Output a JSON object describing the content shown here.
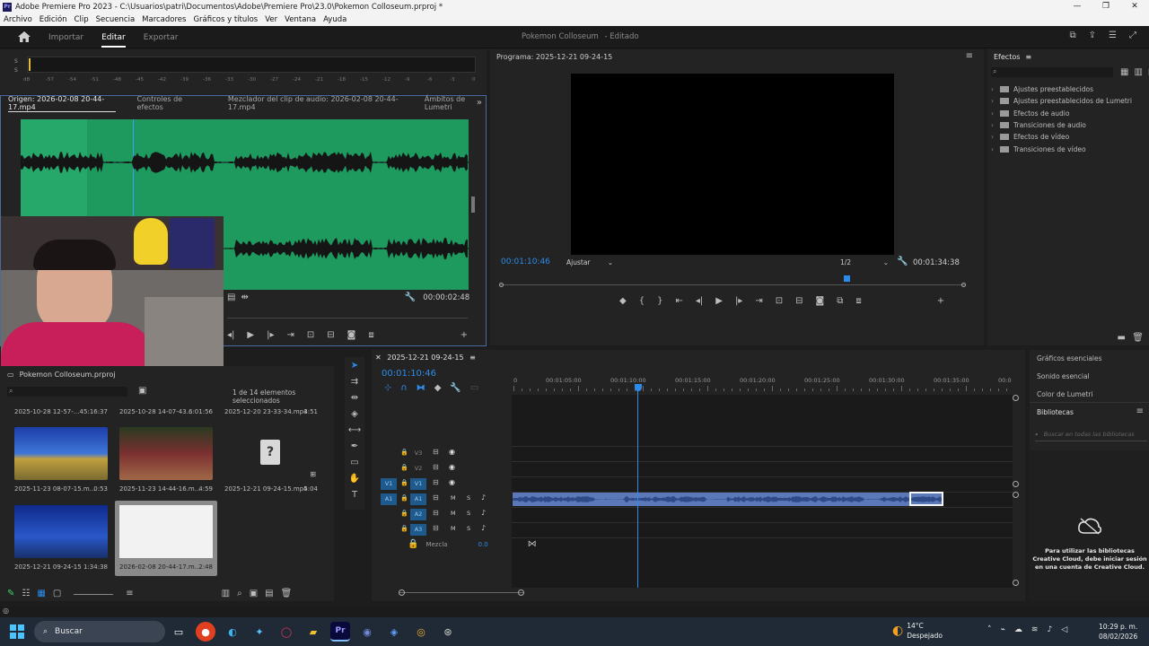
{
  "window": {
    "title": "Adobe Premiere Pro 2023 - C:\\Usuarios\\patri\\Documentos\\Adobe\\Premiere Pro\\23.0\\Pokemon Colloseum.prproj *",
    "icon_text": "Pr",
    "minimize": "—",
    "maximize": "❐",
    "close": "✕"
  },
  "menu": [
    "Archivo",
    "Edición",
    "Clip",
    "Secuencia",
    "Marcadores",
    "Gráficos y títulos",
    "Ver",
    "Ventana",
    "Ayuda"
  ],
  "header": {
    "tabs": [
      "Importar",
      "Editar",
      "Exportar"
    ],
    "active_tab": "Editar",
    "project_title": "Pokemon Colloseum",
    "project_status": "- Editado"
  },
  "audio_meter": {
    "scale": [
      "dB",
      "-57",
      "-54",
      "-51",
      "-48",
      "-45",
      "-42",
      "-39",
      "-36",
      "-33",
      "-30",
      "-27",
      "-24",
      "-21",
      "-18",
      "-15",
      "-12",
      "-9",
      "-6",
      "-3",
      "0"
    ],
    "channel_labels": [
      "S",
      "S"
    ]
  },
  "source_panel": {
    "tabs": [
      "Origen: 2026-02-08 20-44-17.mp4",
      "Controles de efectos",
      "Mezclador del clip de audio: 2026-02-08 20-44-17.mp4",
      "Ámbitos de Lumetri"
    ],
    "active_tab": "Origen: 2026-02-08 20-44-17.mp4",
    "channel_labels": [
      "L",
      "R"
    ],
    "timecode": "00:00:02:48"
  },
  "program_panel": {
    "title": "Programa: 2025-12-21 09-24-15",
    "timecode": "00:01:10:46",
    "fit": "Ajustar",
    "resolution": "1/2",
    "duration": "00:01:34:38"
  },
  "effects_panel": {
    "title": "Efectos",
    "items": [
      "Ajustes preestablecidos",
      "Ajustes preestablecidos de Lumetri",
      "Efectos de audio",
      "Transiciones de audio",
      "Efectos de vídeo",
      "Transiciones de vídeo"
    ]
  },
  "project_panel": {
    "title": "Pokemon Colloseum.prproj",
    "selection_status": "1 de 14 elementos seleccionados",
    "top_row": [
      {
        "name": "2025-10-28 12-57-...",
        "duration": "45:16:37"
      },
      {
        "name": "2025-10-28 14-07-43...",
        "duration": "6:01:56"
      },
      {
        "name": "2025-12-20 23-33-34.mp4",
        "duration": "3:51"
      }
    ],
    "items": [
      {
        "name": "2025-11-23 08-07-15.m...",
        "duration": "0:53"
      },
      {
        "name": "2025-11-23 14-44-16.m...",
        "duration": "4:59"
      },
      {
        "name": "2025-12-21 09-24-15.mp4",
        "duration": "5:04"
      },
      {
        "name": "2025-12-21 09-24-15",
        "duration": "1:34:38"
      },
      {
        "name": "2026-02-08 20-44-17.m...",
        "duration": "2:48"
      }
    ]
  },
  "timeline": {
    "sequence_name": "2025-12-21 09-24-15",
    "timecode": "00:01:10:46",
    "ruler": [
      "0",
      "00:01:05:00",
      "00:01:10:00",
      "00:01:15:00",
      "00:01:20:00",
      "00:01:25:00",
      "00:01:30:00",
      "00:01:35:00",
      "00:0"
    ],
    "video_tracks": [
      "V3",
      "V2",
      "V1"
    ],
    "audio_tracks": [
      "A1",
      "A2",
      "A3"
    ],
    "source_patch_video": "V1",
    "source_patch_audio": "A1",
    "mix_label": "Mezcla",
    "mix_value": "0.0",
    "mute": "M",
    "solo": "S"
  },
  "right_panel": {
    "items": [
      "Gráficos esenciales",
      "Sonido esencial",
      "Color de Lumetri"
    ],
    "libraries_title": "Bibliotecas",
    "search_placeholder": "Buscar en todas las bibliotecas",
    "cc_message": "Para utilizar las bibliotecas Creative Cloud, debe iniciar sesión en una cuenta de Creative Cloud."
  },
  "taskbar": {
    "search_label": "Buscar",
    "weather_temp": "14°C",
    "weather_desc": "Despejado",
    "time": "10:29 p. m.",
    "date": "08/02/2026"
  },
  "colors": {
    "accent_blue": "#2d8ceb",
    "waveform_bg": "#1e9a5f",
    "audio_clip": "#5b79b8",
    "taskbar": "#1f2a36"
  }
}
